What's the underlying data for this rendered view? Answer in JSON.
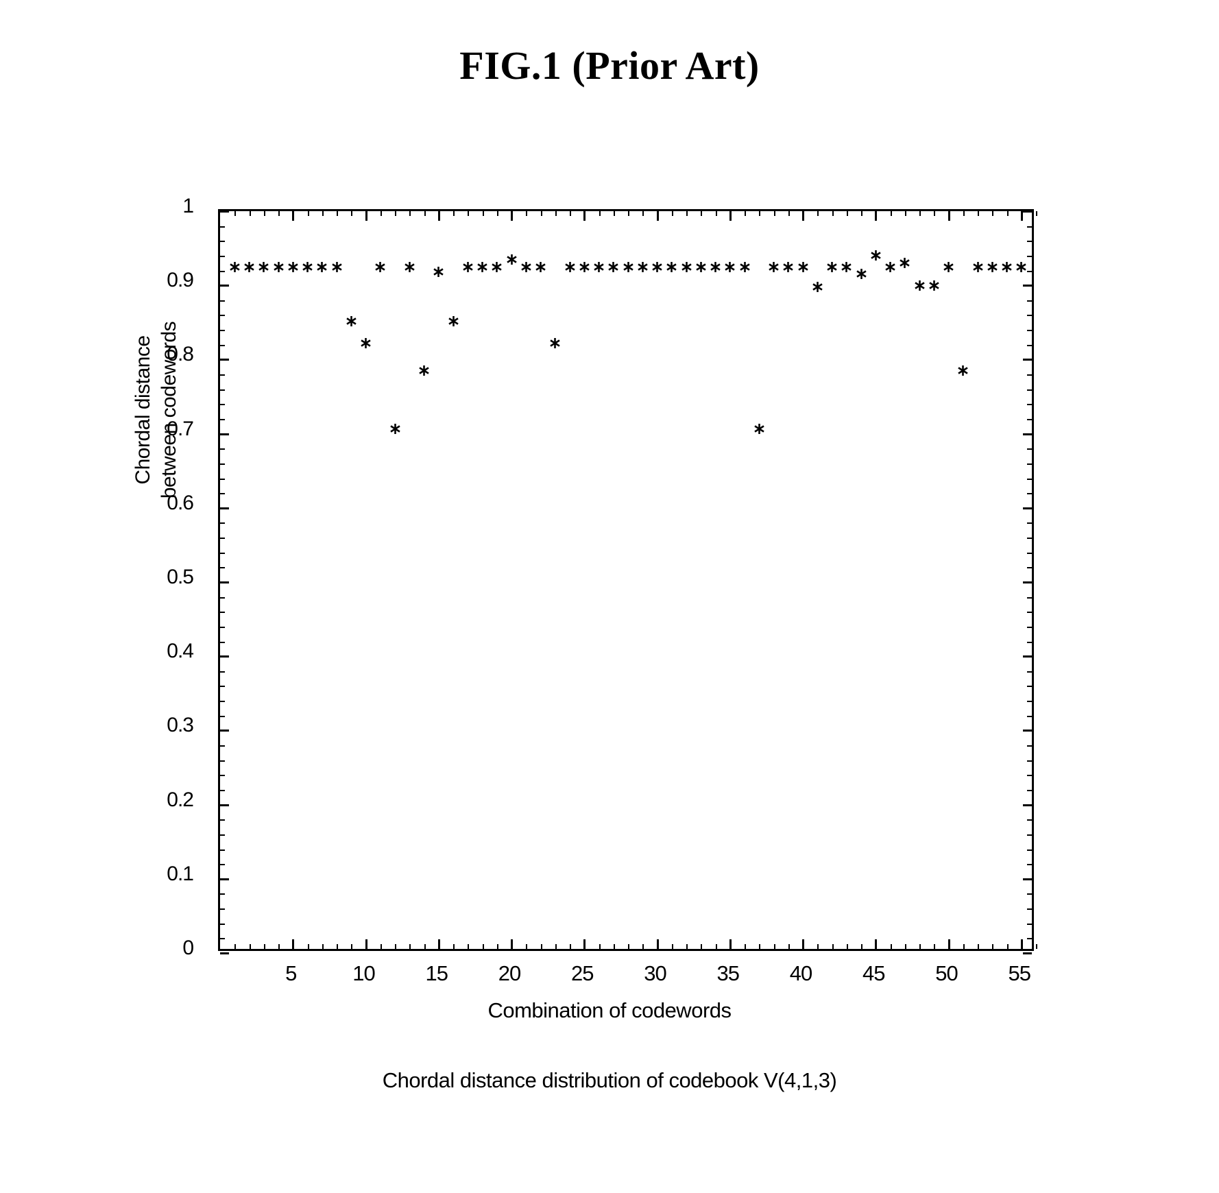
{
  "figure": {
    "title": "FIG.1 (Prior Art)",
    "caption": "Chordal distance distribution of codebook V(4,1,3)"
  },
  "axes": {
    "y_label_line1": "Chordal distance",
    "y_label_line2": "between codewords",
    "x_label": "Combination of codewords",
    "y_ticks": [
      "0",
      "0.1",
      "0.2",
      "0.3",
      "0.4",
      "0.5",
      "0.6",
      "0.7",
      "0.8",
      "0.9",
      "1"
    ],
    "x_ticks": [
      "5",
      "10",
      "15",
      "20",
      "25",
      "30",
      "35",
      "40",
      "45",
      "50",
      "55"
    ]
  },
  "colors": {
    "axis": "#000000",
    "marker": "#000000",
    "background": "#ffffff"
  },
  "chart_data": {
    "type": "scatter",
    "title": "Chordal distance distribution of codebook V(4,1,3)",
    "xlabel": "Combination of codewords",
    "ylabel": "Chordal distance between codewords",
    "xlim": [
      0,
      56
    ],
    "ylim": [
      0,
      1
    ],
    "grid": false,
    "legend": null,
    "marker": "asterisk",
    "x": [
      1,
      2,
      3,
      4,
      5,
      6,
      7,
      8,
      9,
      10,
      11,
      12,
      13,
      14,
      15,
      16,
      17,
      18,
      19,
      20,
      21,
      22,
      23,
      24,
      25,
      26,
      27,
      28,
      29,
      30,
      31,
      32,
      33,
      34,
      35,
      36,
      37,
      38,
      39,
      40,
      41,
      42,
      43,
      44,
      45,
      46,
      47,
      48,
      49,
      50,
      51,
      52,
      53,
      54,
      55
    ],
    "y": [
      0.925,
      0.925,
      0.925,
      0.925,
      0.925,
      0.925,
      0.925,
      0.925,
      0.852,
      0.822,
      0.925,
      0.707,
      0.925,
      0.785,
      0.918,
      0.852,
      0.925,
      0.925,
      0.925,
      0.935,
      0.925,
      0.925,
      0.822,
      0.925,
      0.925,
      0.925,
      0.925,
      0.925,
      0.925,
      0.925,
      0.925,
      0.925,
      0.925,
      0.925,
      0.925,
      0.925,
      0.707,
      0.925,
      0.925,
      0.925,
      0.898,
      0.925,
      0.925,
      0.915,
      0.94,
      0.925,
      0.93,
      0.9,
      0.9,
      0.925,
      0.785,
      0.925,
      0.925,
      0.925,
      0.925
    ]
  }
}
